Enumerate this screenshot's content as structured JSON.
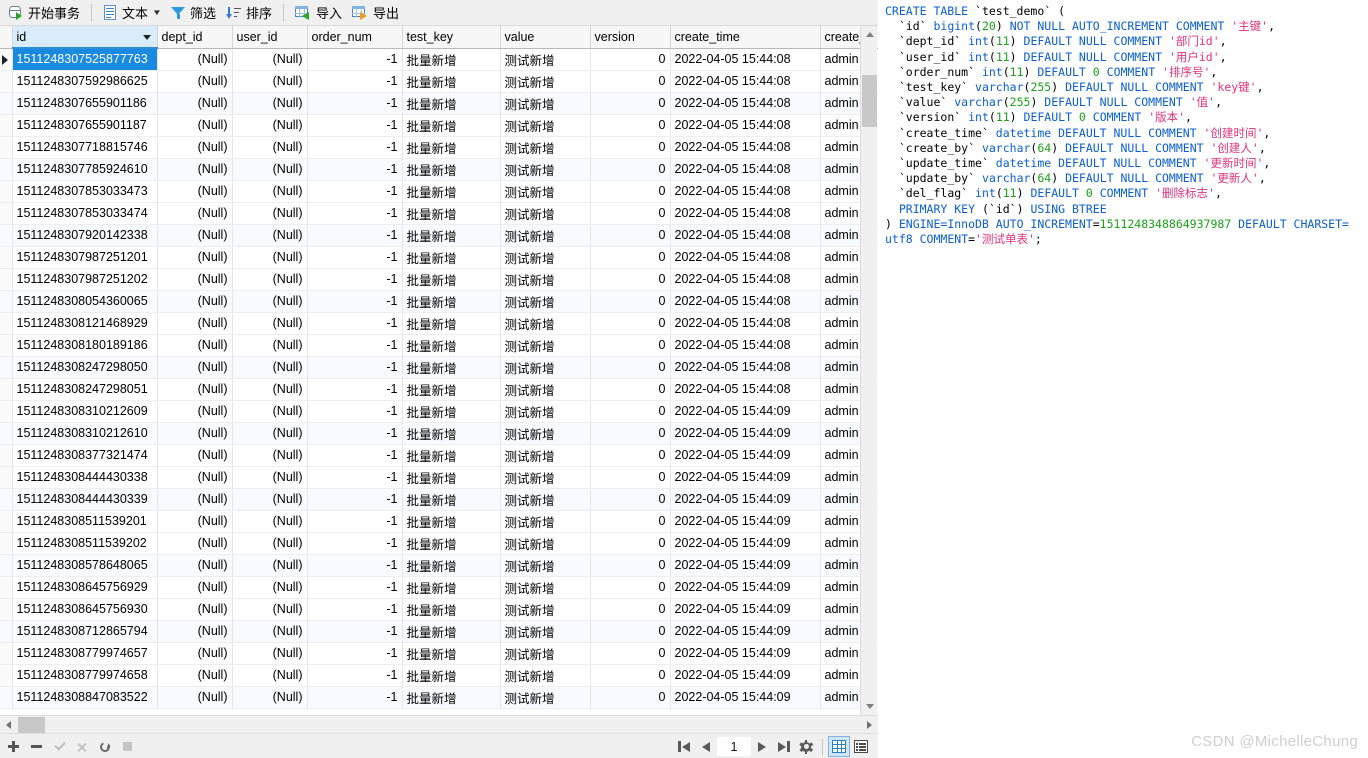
{
  "toolbar": {
    "start_transaction": "开始事务",
    "text": "文本",
    "filter": "筛选",
    "sort": "排序",
    "import": "导入",
    "export": "导出"
  },
  "grid": {
    "columns": [
      {
        "key": "id",
        "label": "id",
        "align": "left",
        "selected": true
      },
      {
        "key": "dept_id",
        "label": "dept_id",
        "align": "right"
      },
      {
        "key": "user_id",
        "label": "user_id",
        "align": "right"
      },
      {
        "key": "order_num",
        "label": "order_num",
        "align": "right"
      },
      {
        "key": "test_key",
        "label": "test_key",
        "align": "left"
      },
      {
        "key": "value",
        "label": "value",
        "align": "left"
      },
      {
        "key": "version",
        "label": "version",
        "align": "right"
      },
      {
        "key": "create_time",
        "label": "create_time",
        "align": "left"
      },
      {
        "key": "create_by",
        "label": "create_b",
        "align": "left"
      }
    ],
    "null_text": "(Null)",
    "rows": [
      {
        "id": "1511248307525877763",
        "dept_id": "(Null)",
        "user_id": "(Null)",
        "order_num": "-1",
        "test_key": "批量新增",
        "value": "测试新增",
        "version": "0",
        "create_time": "2022-04-05 15:44:08",
        "create_by": "admin",
        "selected": true
      },
      {
        "id": "1511248307592986625",
        "dept_id": "(Null)",
        "user_id": "(Null)",
        "order_num": "-1",
        "test_key": "批量新增",
        "value": "测试新增",
        "version": "0",
        "create_time": "2022-04-05 15:44:08",
        "create_by": "admin"
      },
      {
        "id": "1511248307655901186",
        "dept_id": "(Null)",
        "user_id": "(Null)",
        "order_num": "-1",
        "test_key": "批量新增",
        "value": "测试新增",
        "version": "0",
        "create_time": "2022-04-05 15:44:08",
        "create_by": "admin"
      },
      {
        "id": "1511248307655901187",
        "dept_id": "(Null)",
        "user_id": "(Null)",
        "order_num": "-1",
        "test_key": "批量新增",
        "value": "测试新增",
        "version": "0",
        "create_time": "2022-04-05 15:44:08",
        "create_by": "admin"
      },
      {
        "id": "1511248307718815746",
        "dept_id": "(Null)",
        "user_id": "(Null)",
        "order_num": "-1",
        "test_key": "批量新增",
        "value": "测试新增",
        "version": "0",
        "create_time": "2022-04-05 15:44:08",
        "create_by": "admin"
      },
      {
        "id": "1511248307785924610",
        "dept_id": "(Null)",
        "user_id": "(Null)",
        "order_num": "-1",
        "test_key": "批量新增",
        "value": "测试新增",
        "version": "0",
        "create_time": "2022-04-05 15:44:08",
        "create_by": "admin"
      },
      {
        "id": "1511248307853033473",
        "dept_id": "(Null)",
        "user_id": "(Null)",
        "order_num": "-1",
        "test_key": "批量新增",
        "value": "测试新增",
        "version": "0",
        "create_time": "2022-04-05 15:44:08",
        "create_by": "admin"
      },
      {
        "id": "1511248307853033474",
        "dept_id": "(Null)",
        "user_id": "(Null)",
        "order_num": "-1",
        "test_key": "批量新增",
        "value": "测试新增",
        "version": "0",
        "create_time": "2022-04-05 15:44:08",
        "create_by": "admin"
      },
      {
        "id": "1511248307920142338",
        "dept_id": "(Null)",
        "user_id": "(Null)",
        "order_num": "-1",
        "test_key": "批量新增",
        "value": "测试新增",
        "version": "0",
        "create_time": "2022-04-05 15:44:08",
        "create_by": "admin"
      },
      {
        "id": "1511248307987251201",
        "dept_id": "(Null)",
        "user_id": "(Null)",
        "order_num": "-1",
        "test_key": "批量新增",
        "value": "测试新增",
        "version": "0",
        "create_time": "2022-04-05 15:44:08",
        "create_by": "admin"
      },
      {
        "id": "1511248307987251202",
        "dept_id": "(Null)",
        "user_id": "(Null)",
        "order_num": "-1",
        "test_key": "批量新增",
        "value": "测试新增",
        "version": "0",
        "create_time": "2022-04-05 15:44:08",
        "create_by": "admin"
      },
      {
        "id": "1511248308054360065",
        "dept_id": "(Null)",
        "user_id": "(Null)",
        "order_num": "-1",
        "test_key": "批量新增",
        "value": "测试新增",
        "version": "0",
        "create_time": "2022-04-05 15:44:08",
        "create_by": "admin"
      },
      {
        "id": "1511248308121468929",
        "dept_id": "(Null)",
        "user_id": "(Null)",
        "order_num": "-1",
        "test_key": "批量新增",
        "value": "测试新增",
        "version": "0",
        "create_time": "2022-04-05 15:44:08",
        "create_by": "admin"
      },
      {
        "id": "1511248308180189186",
        "dept_id": "(Null)",
        "user_id": "(Null)",
        "order_num": "-1",
        "test_key": "批量新增",
        "value": "测试新增",
        "version": "0",
        "create_time": "2022-04-05 15:44:08",
        "create_by": "admin"
      },
      {
        "id": "1511248308247298050",
        "dept_id": "(Null)",
        "user_id": "(Null)",
        "order_num": "-1",
        "test_key": "批量新增",
        "value": "测试新增",
        "version": "0",
        "create_time": "2022-04-05 15:44:08",
        "create_by": "admin"
      },
      {
        "id": "1511248308247298051",
        "dept_id": "(Null)",
        "user_id": "(Null)",
        "order_num": "-1",
        "test_key": "批量新增",
        "value": "测试新增",
        "version": "0",
        "create_time": "2022-04-05 15:44:08",
        "create_by": "admin"
      },
      {
        "id": "1511248308310212609",
        "dept_id": "(Null)",
        "user_id": "(Null)",
        "order_num": "-1",
        "test_key": "批量新增",
        "value": "测试新增",
        "version": "0",
        "create_time": "2022-04-05 15:44:09",
        "create_by": "admin"
      },
      {
        "id": "1511248308310212610",
        "dept_id": "(Null)",
        "user_id": "(Null)",
        "order_num": "-1",
        "test_key": "批量新增",
        "value": "测试新增",
        "version": "0",
        "create_time": "2022-04-05 15:44:09",
        "create_by": "admin"
      },
      {
        "id": "1511248308377321474",
        "dept_id": "(Null)",
        "user_id": "(Null)",
        "order_num": "-1",
        "test_key": "批量新增",
        "value": "测试新增",
        "version": "0",
        "create_time": "2022-04-05 15:44:09",
        "create_by": "admin"
      },
      {
        "id": "1511248308444430338",
        "dept_id": "(Null)",
        "user_id": "(Null)",
        "order_num": "-1",
        "test_key": "批量新增",
        "value": "测试新增",
        "version": "0",
        "create_time": "2022-04-05 15:44:09",
        "create_by": "admin"
      },
      {
        "id": "1511248308444430339",
        "dept_id": "(Null)",
        "user_id": "(Null)",
        "order_num": "-1",
        "test_key": "批量新增",
        "value": "测试新增",
        "version": "0",
        "create_time": "2022-04-05 15:44:09",
        "create_by": "admin"
      },
      {
        "id": "1511248308511539201",
        "dept_id": "(Null)",
        "user_id": "(Null)",
        "order_num": "-1",
        "test_key": "批量新增",
        "value": "测试新增",
        "version": "0",
        "create_time": "2022-04-05 15:44:09",
        "create_by": "admin"
      },
      {
        "id": "1511248308511539202",
        "dept_id": "(Null)",
        "user_id": "(Null)",
        "order_num": "-1",
        "test_key": "批量新增",
        "value": "测试新增",
        "version": "0",
        "create_time": "2022-04-05 15:44:09",
        "create_by": "admin"
      },
      {
        "id": "1511248308578648065",
        "dept_id": "(Null)",
        "user_id": "(Null)",
        "order_num": "-1",
        "test_key": "批量新增",
        "value": "测试新增",
        "version": "0",
        "create_time": "2022-04-05 15:44:09",
        "create_by": "admin"
      },
      {
        "id": "1511248308645756929",
        "dept_id": "(Null)",
        "user_id": "(Null)",
        "order_num": "-1",
        "test_key": "批量新增",
        "value": "测试新增",
        "version": "0",
        "create_time": "2022-04-05 15:44:09",
        "create_by": "admin"
      },
      {
        "id": "1511248308645756930",
        "dept_id": "(Null)",
        "user_id": "(Null)",
        "order_num": "-1",
        "test_key": "批量新增",
        "value": "测试新增",
        "version": "0",
        "create_time": "2022-04-05 15:44:09",
        "create_by": "admin"
      },
      {
        "id": "1511248308712865794",
        "dept_id": "(Null)",
        "user_id": "(Null)",
        "order_num": "-1",
        "test_key": "批量新增",
        "value": "测试新增",
        "version": "0",
        "create_time": "2022-04-05 15:44:09",
        "create_by": "admin"
      },
      {
        "id": "1511248308779974657",
        "dept_id": "(Null)",
        "user_id": "(Null)",
        "order_num": "-1",
        "test_key": "批量新增",
        "value": "测试新增",
        "version": "0",
        "create_time": "2022-04-05 15:44:09",
        "create_by": "admin"
      },
      {
        "id": "1511248308779974658",
        "dept_id": "(Null)",
        "user_id": "(Null)",
        "order_num": "-1",
        "test_key": "批量新增",
        "value": "测试新增",
        "version": "0",
        "create_time": "2022-04-05 15:44:09",
        "create_by": "admin"
      },
      {
        "id": "1511248308847083522",
        "dept_id": "(Null)",
        "user_id": "(Null)",
        "order_num": "-1",
        "test_key": "批量新增",
        "value": "测试新增",
        "version": "0",
        "create_time": "2022-04-05 15:44:09",
        "create_by": "admin"
      }
    ]
  },
  "statusbar": {
    "page_value": "1",
    "actions": [
      "add-record",
      "delete-record",
      "apply-change",
      "cancel-change",
      "refresh",
      "stop"
    ],
    "pager": [
      "first-page",
      "previous-page",
      "page-number",
      "next-page",
      "last-page",
      "settings"
    ],
    "views": [
      "grid-view",
      "form-view"
    ]
  },
  "sql": {
    "tokens": [
      {
        "t": "CREATE TABLE ",
        "c": "k"
      },
      {
        "t": "`test_demo`",
        "c": "id"
      },
      {
        "t": " (\n  ",
        "c": "plain"
      },
      {
        "t": "`id`",
        "c": "id"
      },
      {
        "t": " bigint",
        "c": "k"
      },
      {
        "t": "(",
        "c": "plain"
      },
      {
        "t": "20",
        "c": "num-lit"
      },
      {
        "t": ") ",
        "c": "plain"
      },
      {
        "t": "NOT NULL AUTO_INCREMENT COMMENT ",
        "c": "k"
      },
      {
        "t": "'主键'",
        "c": "str"
      },
      {
        "t": ",\n  ",
        "c": "plain"
      },
      {
        "t": "`dept_id`",
        "c": "id"
      },
      {
        "t": " int",
        "c": "k"
      },
      {
        "t": "(",
        "c": "plain"
      },
      {
        "t": "11",
        "c": "num-lit"
      },
      {
        "t": ") ",
        "c": "plain"
      },
      {
        "t": "DEFAULT NULL COMMENT ",
        "c": "k"
      },
      {
        "t": "'部门id'",
        "c": "str"
      },
      {
        "t": ",\n  ",
        "c": "plain"
      },
      {
        "t": "`user_id`",
        "c": "id"
      },
      {
        "t": " int",
        "c": "k"
      },
      {
        "t": "(",
        "c": "plain"
      },
      {
        "t": "11",
        "c": "num-lit"
      },
      {
        "t": ") ",
        "c": "plain"
      },
      {
        "t": "DEFAULT NULL COMMENT ",
        "c": "k"
      },
      {
        "t": "'用户id'",
        "c": "str"
      },
      {
        "t": ",\n  ",
        "c": "plain"
      },
      {
        "t": "`order_num`",
        "c": "id"
      },
      {
        "t": " int",
        "c": "k"
      },
      {
        "t": "(",
        "c": "plain"
      },
      {
        "t": "11",
        "c": "num-lit"
      },
      {
        "t": ") ",
        "c": "plain"
      },
      {
        "t": "DEFAULT ",
        "c": "k"
      },
      {
        "t": "0",
        "c": "num-lit"
      },
      {
        "t": " ",
        "c": "plain"
      },
      {
        "t": "COMMENT ",
        "c": "k"
      },
      {
        "t": "'排序号'",
        "c": "str"
      },
      {
        "t": ",\n  ",
        "c": "plain"
      },
      {
        "t": "`test_key`",
        "c": "id"
      },
      {
        "t": " varchar",
        "c": "k"
      },
      {
        "t": "(",
        "c": "plain"
      },
      {
        "t": "255",
        "c": "num-lit"
      },
      {
        "t": ") ",
        "c": "plain"
      },
      {
        "t": "DEFAULT NULL COMMENT ",
        "c": "k"
      },
      {
        "t": "'key键'",
        "c": "str"
      },
      {
        "t": ",\n  ",
        "c": "plain"
      },
      {
        "t": "`value`",
        "c": "id"
      },
      {
        "t": " varchar",
        "c": "k"
      },
      {
        "t": "(",
        "c": "plain"
      },
      {
        "t": "255",
        "c": "num-lit"
      },
      {
        "t": ") ",
        "c": "plain"
      },
      {
        "t": "DEFAULT NULL COMMENT ",
        "c": "k"
      },
      {
        "t": "'值'",
        "c": "str"
      },
      {
        "t": ",\n  ",
        "c": "plain"
      },
      {
        "t": "`version`",
        "c": "id"
      },
      {
        "t": " int",
        "c": "k"
      },
      {
        "t": "(",
        "c": "plain"
      },
      {
        "t": "11",
        "c": "num-lit"
      },
      {
        "t": ") ",
        "c": "plain"
      },
      {
        "t": "DEFAULT ",
        "c": "k"
      },
      {
        "t": "0",
        "c": "num-lit"
      },
      {
        "t": " ",
        "c": "plain"
      },
      {
        "t": "COMMENT ",
        "c": "k"
      },
      {
        "t": "'版本'",
        "c": "str"
      },
      {
        "t": ",\n  ",
        "c": "plain"
      },
      {
        "t": "`create_time`",
        "c": "id"
      },
      {
        "t": " datetime ",
        "c": "k"
      },
      {
        "t": "DEFAULT NULL COMMENT ",
        "c": "k"
      },
      {
        "t": "'创建时间'",
        "c": "str"
      },
      {
        "t": ",\n  ",
        "c": "plain"
      },
      {
        "t": "`create_by`",
        "c": "id"
      },
      {
        "t": " varchar",
        "c": "k"
      },
      {
        "t": "(",
        "c": "plain"
      },
      {
        "t": "64",
        "c": "num-lit"
      },
      {
        "t": ") ",
        "c": "plain"
      },
      {
        "t": "DEFAULT NULL COMMENT ",
        "c": "k"
      },
      {
        "t": "'创建人'",
        "c": "str"
      },
      {
        "t": ",\n  ",
        "c": "plain"
      },
      {
        "t": "`update_time`",
        "c": "id"
      },
      {
        "t": " datetime ",
        "c": "k"
      },
      {
        "t": "DEFAULT NULL COMMENT ",
        "c": "k"
      },
      {
        "t": "'更新时间'",
        "c": "str"
      },
      {
        "t": ",\n  ",
        "c": "plain"
      },
      {
        "t": "`update_by`",
        "c": "id"
      },
      {
        "t": " varchar",
        "c": "k"
      },
      {
        "t": "(",
        "c": "plain"
      },
      {
        "t": "64",
        "c": "num-lit"
      },
      {
        "t": ") ",
        "c": "plain"
      },
      {
        "t": "DEFAULT NULL COMMENT ",
        "c": "k"
      },
      {
        "t": "'更新人'",
        "c": "str"
      },
      {
        "t": ",\n  ",
        "c": "plain"
      },
      {
        "t": "`del_flag`",
        "c": "id"
      },
      {
        "t": " int",
        "c": "k"
      },
      {
        "t": "(",
        "c": "plain"
      },
      {
        "t": "11",
        "c": "num-lit"
      },
      {
        "t": ") ",
        "c": "plain"
      },
      {
        "t": "DEFAULT ",
        "c": "k"
      },
      {
        "t": "0",
        "c": "num-lit"
      },
      {
        "t": " ",
        "c": "plain"
      },
      {
        "t": "COMMENT ",
        "c": "k"
      },
      {
        "t": "'删除标志'",
        "c": "str"
      },
      {
        "t": ",\n  ",
        "c": "plain"
      },
      {
        "t": "PRIMARY KEY ",
        "c": "k"
      },
      {
        "t": "(",
        "c": "plain"
      },
      {
        "t": "`id`",
        "c": "id"
      },
      {
        "t": ") ",
        "c": "plain"
      },
      {
        "t": "USING BTREE",
        "c": "k"
      },
      {
        "t": "\n) ",
        "c": "plain"
      },
      {
        "t": "ENGINE",
        "c": "k"
      },
      {
        "t": "=InnoDB ",
        "c": "k"
      },
      {
        "t": "AUTO_INCREMENT",
        "c": "k"
      },
      {
        "t": "=",
        "c": "plain"
      },
      {
        "t": "1511248348864937987",
        "c": "num-lit"
      },
      {
        "t": " DEFAULT CHARSET",
        "c": "k"
      },
      {
        "t": "=\nutf8 ",
        "c": "k"
      },
      {
        "t": "COMMENT",
        "c": "k"
      },
      {
        "t": "=",
        "c": "plain"
      },
      {
        "t": "'测试单表'",
        "c": "str"
      },
      {
        "t": ";",
        "c": "plain"
      }
    ]
  },
  "watermark": "CSDN @MichelleChung"
}
